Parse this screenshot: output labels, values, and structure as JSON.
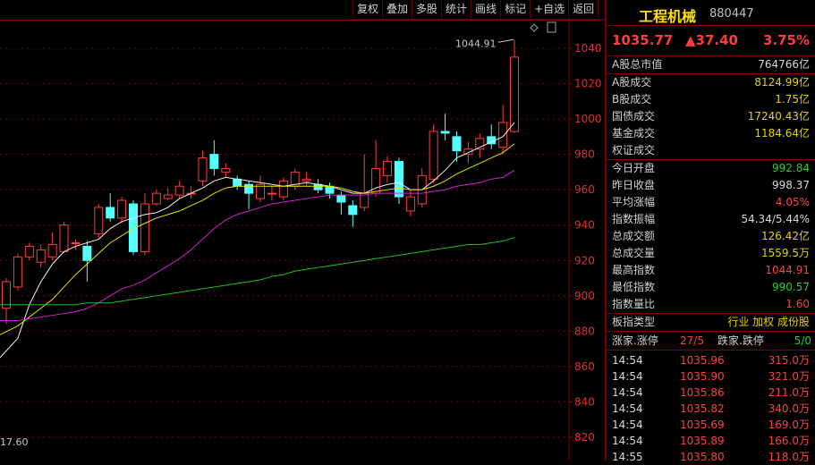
{
  "toolbar": [
    "复权",
    "叠加",
    "多股",
    "统计",
    "画线",
    "标记",
    "+自选",
    "返回"
  ],
  "chart": {
    "y_ticks": [
      "1040",
      "1020",
      "1000",
      "980",
      "960",
      "940",
      "920",
      "900",
      "880",
      "860",
      "840",
      "820"
    ],
    "high_label": "1044.91",
    "bottom_left_label": "17.60"
  },
  "chart_data": {
    "type": "candlestick",
    "ylim": [
      815,
      1050
    ],
    "high": 1044.91,
    "candles": [
      [
        893,
        908,
        884,
        910
      ],
      [
        905,
        922,
        903,
        924
      ],
      [
        922,
        928,
        920,
        930
      ],
      [
        919,
        926,
        916,
        929
      ],
      [
        922,
        929,
        920,
        936
      ],
      [
        925,
        940,
        924,
        942
      ],
      [
        930,
        930,
        926,
        932
      ],
      [
        928,
        920,
        908,
        931
      ],
      [
        935,
        950,
        933,
        952
      ],
      [
        950,
        944,
        942,
        958
      ],
      [
        944,
        954,
        941,
        956
      ],
      [
        952,
        925,
        923,
        954
      ],
      [
        925,
        952,
        923,
        958
      ],
      [
        952,
        958,
        951,
        960
      ],
      [
        955,
        957,
        954,
        961
      ],
      [
        957,
        962,
        955,
        965
      ],
      [
        958,
        958,
        955,
        962
      ],
      [
        965,
        978,
        962,
        982
      ],
      [
        980,
        972,
        968,
        988
      ],
      [
        970,
        972,
        967,
        975
      ],
      [
        966,
        962,
        960,
        968
      ],
      [
        963,
        958,
        949,
        965
      ],
      [
        955,
        963,
        953,
        968
      ],
      [
        958,
        958,
        954,
        962
      ],
      [
        956,
        965,
        954,
        967
      ],
      [
        962,
        970,
        960,
        972
      ],
      [
        965,
        966,
        962,
        970
      ],
      [
        963,
        960,
        958,
        966
      ],
      [
        962,
        958,
        955,
        964
      ],
      [
        957,
        953,
        946,
        959
      ],
      [
        951,
        946,
        939,
        954
      ],
      [
        950,
        958,
        948,
        980
      ],
      [
        958,
        972,
        956,
        988
      ],
      [
        968,
        976,
        964,
        979
      ],
      [
        976,
        956,
        952,
        978
      ],
      [
        948,
        956,
        945,
        960
      ],
      [
        952,
        968,
        950,
        972
      ],
      [
        966,
        993,
        964,
        997
      ],
      [
        993,
        992,
        988,
        1003
      ],
      [
        990,
        982,
        976,
        993
      ],
      [
        980,
        983,
        975,
        987
      ],
      [
        983,
        989,
        978,
        992
      ],
      [
        990,
        986,
        983,
        997
      ],
      [
        984,
        998,
        980,
        1008
      ],
      [
        993,
        1035,
        992,
        1044.91
      ]
    ],
    "ma5": [
      865,
      876,
      895,
      908,
      918,
      925,
      928,
      930,
      932,
      938,
      942,
      944,
      946,
      947,
      950,
      955,
      958,
      961,
      965,
      967,
      966,
      965,
      964,
      963,
      962,
      963,
      964,
      963,
      962,
      960,
      958,
      958,
      961,
      963,
      964,
      960,
      960,
      965,
      971,
      978,
      981,
      984,
      987,
      990,
      998
    ],
    "ma10": [
      878,
      883,
      888,
      893,
      898,
      905,
      912,
      918,
      924,
      930,
      934,
      938,
      941,
      944,
      946,
      948,
      951,
      954,
      958,
      961,
      962,
      962,
      962,
      962,
      962,
      962,
      962,
      962,
      962,
      961,
      959,
      958,
      959,
      960,
      961,
      960,
      960,
      962,
      965,
      969,
      972,
      975,
      978,
      981,
      986
    ],
    "ma20": [
      886,
      886,
      887,
      888,
      889,
      890,
      891,
      893,
      896,
      900,
      904,
      906,
      909,
      913,
      917,
      921,
      926,
      932,
      938,
      943,
      946,
      948,
      950,
      952,
      953,
      954,
      955,
      956,
      957,
      957,
      957,
      957,
      958,
      958,
      958,
      958,
      958,
      959,
      960,
      962,
      963,
      964,
      966,
      967,
      971
    ],
    "ma60": [
      895,
      895,
      895,
      895,
      895,
      895,
      895,
      896,
      896,
      896,
      897,
      898,
      899,
      900,
      901,
      902,
      903,
      904,
      905,
      906,
      907,
      908,
      909,
      911,
      912,
      914,
      915,
      916,
      917,
      918,
      919,
      920,
      921,
      922,
      923,
      924,
      925,
      926,
      927,
      928,
      929,
      929,
      930,
      931,
      933
    ]
  },
  "info": {
    "name": "工程机械",
    "code": "880447",
    "price": "1035.77",
    "change": "▲37.40",
    "pct": "3.75%",
    "market_cap": {
      "label": "A股总市值",
      "value": "764766亿"
    },
    "turnover": [
      {
        "label": "A股成交",
        "value": "8124.99亿"
      },
      {
        "label": "B股成交",
        "value": "1.75亿"
      },
      {
        "label": "国债成交",
        "value": "17240.43亿"
      },
      {
        "label": "基金成交",
        "value": "1184.64亿"
      },
      {
        "label": "权证成交",
        "value": ""
      }
    ],
    "stats": [
      {
        "label": "今日开盘",
        "value": "992.84",
        "color": "grn"
      },
      {
        "label": "昨日收盘",
        "value": "998.37",
        "color": "wht"
      },
      {
        "label": "平均涨幅",
        "value": "4.05%",
        "color": "red"
      },
      {
        "label": "指数振幅",
        "value": "54.34/5.44%",
        "color": "wht"
      },
      {
        "label": "总成交额",
        "value": "126.42亿",
        "color": "yel"
      },
      {
        "label": "总成交量",
        "value": "1559.5万",
        "color": "yel"
      },
      {
        "label": "最高指数",
        "value": "1044.91",
        "color": "red"
      },
      {
        "label": "最低指数",
        "value": "990.57",
        "color": "grn"
      },
      {
        "label": "指数量比",
        "value": "1.60",
        "color": "red"
      }
    ],
    "sector_type": {
      "label": "板指类型",
      "value": "行业 加权 成份股"
    },
    "updown": {
      "up_label": "涨家.涨停",
      "up_value": "27/5",
      "down_label": "跌家.跌停",
      "down_value": "5/0"
    },
    "ticks": [
      {
        "time": "14:54",
        "price": "1035.96",
        "vol": "315.0万"
      },
      {
        "time": "14:54",
        "price": "1035.90",
        "vol": "321.0万"
      },
      {
        "time": "14:54",
        "price": "1035.86",
        "vol": "211.0万"
      },
      {
        "time": "14:54",
        "price": "1035.82",
        "vol": "340.0万"
      },
      {
        "time": "14:54",
        "price": "1035.69",
        "vol": "169.0万"
      },
      {
        "time": "14:54",
        "price": "1035.89",
        "vol": "166.0万"
      },
      {
        "time": "14:55",
        "price": "1035.80",
        "vol": "118.0万"
      }
    ]
  }
}
